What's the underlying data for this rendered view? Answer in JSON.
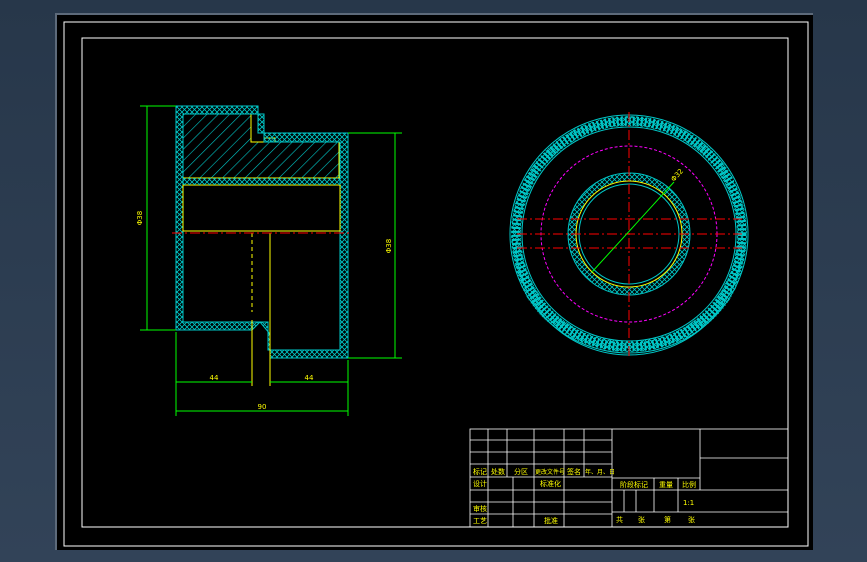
{
  "colors": {
    "background": "#000000",
    "frame": "#ffffff",
    "hatch": "#00c8c8",
    "outline": "#ffff00",
    "dimension": "#00ff00",
    "centerline": "#ff0000",
    "pitch_circle": "#ff00ff",
    "text": "#ffff00"
  },
  "dimensions": {
    "left_height": "Φ38",
    "right_height": "Φ38",
    "bottom_left": "44",
    "bottom_right": "44",
    "overall_width": "90",
    "hole_diameter": "Φ32"
  },
  "title_block": {
    "row_headers": [
      "标记",
      "处数",
      "分区",
      "更改文件号",
      "签名",
      "年、月、日"
    ],
    "design": "设计",
    "standardization": "标准化",
    "review": "审核",
    "process": "工艺",
    "approve": "批准",
    "stage_mark": "阶段标记",
    "weight": "重量",
    "scale": "比例",
    "scale_value": "1:1",
    "sheet_total": "共",
    "sheet_word": "张",
    "sheet_no": "第",
    "sheet_word2": "张"
  }
}
